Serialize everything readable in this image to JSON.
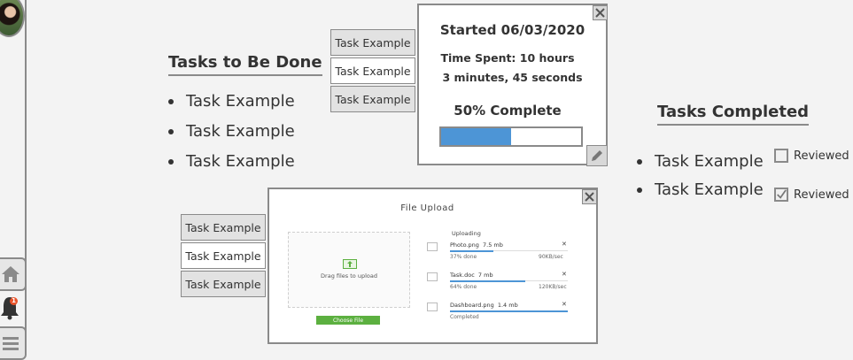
{
  "todo": {
    "title": "Tasks to Be Done",
    "items": [
      "Task Example",
      "Task Example",
      "Task Example"
    ]
  },
  "timer_tabs": [
    "Task Example",
    "Task Example",
    "Task Example"
  ],
  "upload_tabs": [
    "Task Example",
    "Task Example",
    "Task Example"
  ],
  "timer": {
    "started": "Started 06/03/2020",
    "time_spent_line1": "Time Spent: 10 hours",
    "time_spent_line2": "3 minutes, 45 seconds",
    "percent_label": "50% Complete",
    "progress": 0.5
  },
  "completed": {
    "title": "Tasks Completed",
    "items": [
      {
        "label": "Task Example",
        "reviewed_label": "Reviewed",
        "reviewed": false
      },
      {
        "label": "Task Example",
        "reviewed_label": "Reviewed",
        "reviewed": true
      }
    ]
  },
  "upload": {
    "title": "File Upload",
    "drop_text": "Drag files to upload",
    "choose_label": "Choose File",
    "uploading_label": "Uploading",
    "files": [
      {
        "name": "Photo.png",
        "size": "7.5 mb",
        "status": "37% done",
        "rate": "90KB/sec",
        "progress": 0.37
      },
      {
        "name": "Task.doc",
        "size": "7 mb",
        "status": "64% done",
        "rate": "120KB/sec",
        "progress": 0.64
      },
      {
        "name": "Dashboard.png",
        "size": "1.4 mb",
        "status": "Completed",
        "rate": "",
        "progress": 1.0
      }
    ]
  },
  "notifications": {
    "count": "1"
  },
  "colors": {
    "accent": "#4d95d6",
    "success": "#5cb040",
    "badge": "#e8532b"
  }
}
